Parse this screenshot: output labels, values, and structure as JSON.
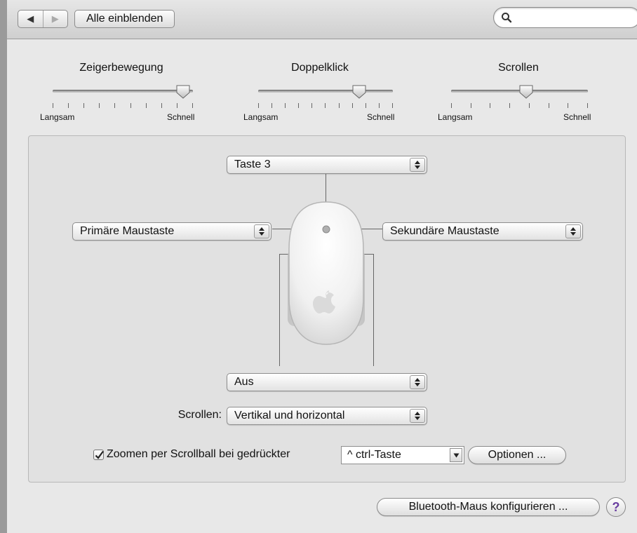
{
  "toolbar": {
    "back_glyph": "◀",
    "forward_glyph": "▶",
    "show_all_label": "Alle einblenden",
    "search": {
      "placeholder": "",
      "value": "",
      "icon": "magnifier-icon"
    }
  },
  "sliders": [
    {
      "title": "Zeigerbewegung",
      "min_label": "Langsam",
      "max_label": "Schnell",
      "value": 0.93,
      "tick_count": 10
    },
    {
      "title": "Doppelklick",
      "min_label": "Langsam",
      "max_label": "Schnell",
      "value": 0.75,
      "tick_count": 11
    },
    {
      "title": "Scrollen",
      "min_label": "Langsam",
      "max_label": "Schnell",
      "value": 0.55,
      "tick_count": 8
    }
  ],
  "mouse": {
    "top_button": "Taste 3",
    "left_button": "Primäre Maustaste",
    "right_button": "Sekundäre Maustaste",
    "side_buttons": "Aus"
  },
  "scrolling": {
    "label": "Scrollen:",
    "value": "Vertikal und horizontal"
  },
  "zoom": {
    "checked": true,
    "label": "Zoomen per Scrollball bei gedrückter",
    "modifier": "^ ctrl-Taste",
    "options_label": "Optionen ..."
  },
  "bluetooth_button": "Bluetooth-Maus konfigurieren ...",
  "help_label": "?"
}
